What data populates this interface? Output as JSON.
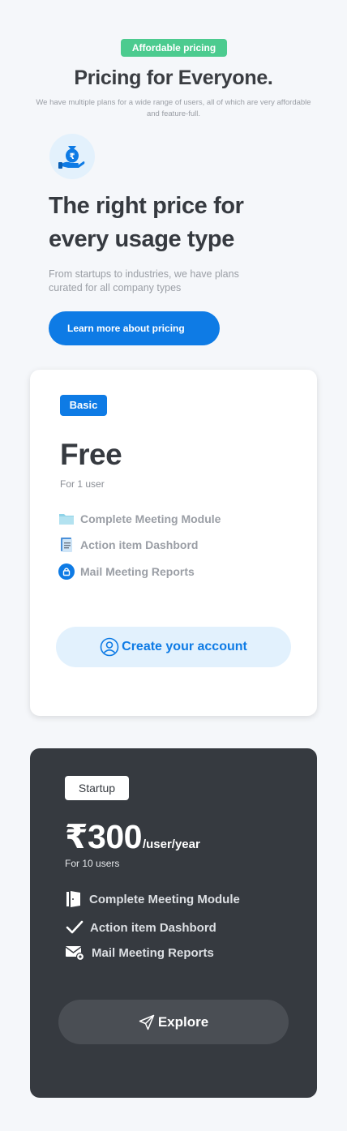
{
  "header": {
    "badge": "Affordable pricing",
    "title": "Pricing for Everyone.",
    "subtitle": "We have multiple plans for a wide range of users, all of which are very affordable and feature-full."
  },
  "hero": {
    "icon": "money-bag-hand-icon",
    "title": "The right price for every usage type",
    "subtitle": "From startups to industries, we have plans curated for all company types",
    "button_label": "Learn more about pricing"
  },
  "plans": [
    {
      "tag": "Basic",
      "price": "Free",
      "users": "For 1 user",
      "features": [
        {
          "icon": "folder-icon",
          "label": "Complete Meeting Module"
        },
        {
          "icon": "document-icon",
          "label": "Action item Dashbord"
        },
        {
          "icon": "lock-icon",
          "label": "Mail Meeting Reports"
        }
      ],
      "button": {
        "icon": "user-circle-icon",
        "label": "Create your account"
      }
    },
    {
      "tag": "Startup",
      "price": "₹300",
      "period": "/user/year",
      "users": "For 10 users",
      "features": [
        {
          "icon": "door-icon",
          "label": "Complete Meeting Module"
        },
        {
          "icon": "check-icon",
          "label": "Action item Dashbord"
        },
        {
          "icon": "mail-icon",
          "label": "Mail Meeting Reports"
        }
      ],
      "button": {
        "icon": "send-icon",
        "label": "Explore"
      }
    }
  ],
  "colors": {
    "accent": "#0e7be5",
    "badge_green": "#4ccb8f",
    "dark_card": "#363a40",
    "background": "#f5f7fa"
  }
}
